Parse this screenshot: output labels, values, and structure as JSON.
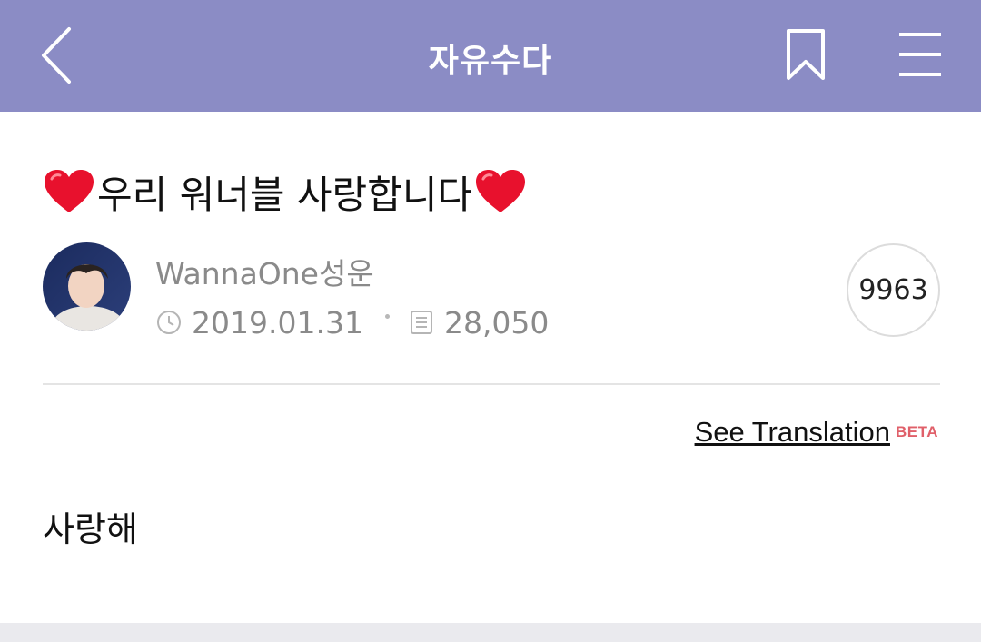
{
  "header": {
    "title": "자유수다",
    "background": "#8b8cc5",
    "back_icon": "chevron-left-icon",
    "bookmark_icon": "bookmark-icon",
    "menu_icon": "hamburger-menu-icon"
  },
  "post": {
    "title": "우리 워너블 사랑합니다",
    "title_prefix_emoji": "heart-icon",
    "title_suffix_emoji": "heart-icon",
    "author": "WannaOne성운",
    "date": "2019.01.31",
    "views": "28,050",
    "like_count": "9963",
    "body": "사랑해"
  },
  "translation": {
    "link_label": "See Translation",
    "badge": "BETA",
    "badge_color": "#e0606a"
  }
}
